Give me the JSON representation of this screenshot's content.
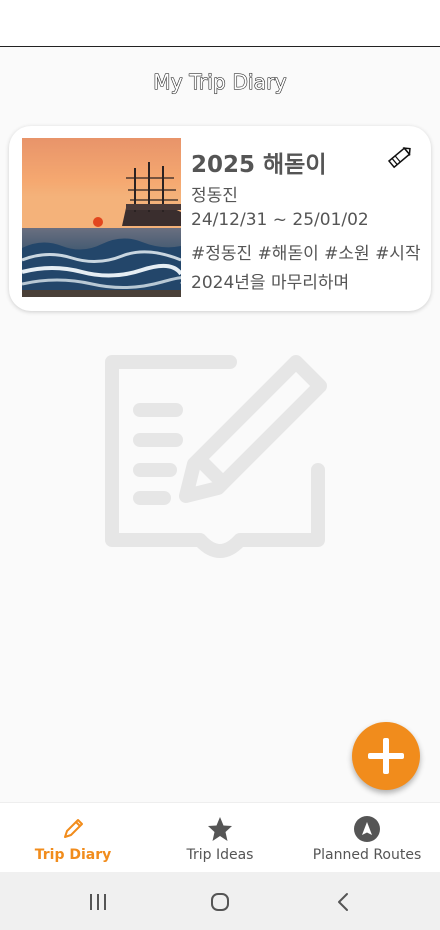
{
  "header": {
    "title": "My Trip Diary"
  },
  "entries": [
    {
      "title": "2025 해돋이",
      "location": "정동진",
      "dates": "24/12/31 ~ 25/01/02",
      "tags": "#정동진 #해돋이 #소원 #시작",
      "memo": "2024년을 마무리하며",
      "thumbnail": "sunset-sea-ship-photo",
      "edit_icon": "pencil-icon"
    }
  ],
  "empty_illustration": "notebook-pencil-icon",
  "fab": {
    "icon": "plus-icon",
    "color": "#f18c1c"
  },
  "bottom_nav": [
    {
      "label": "Trip Diary",
      "icon": "pencil-icon",
      "active": true
    },
    {
      "label": "Trip Ideas",
      "icon": "star-icon",
      "active": false
    },
    {
      "label": "Planned Routes",
      "icon": "navigation-icon",
      "active": false
    }
  ],
  "system_nav": [
    "recents-icon",
    "home-icon",
    "back-icon"
  ],
  "colors": {
    "accent": "#f18c1c",
    "text": "#555555",
    "background": "#fafafa"
  }
}
